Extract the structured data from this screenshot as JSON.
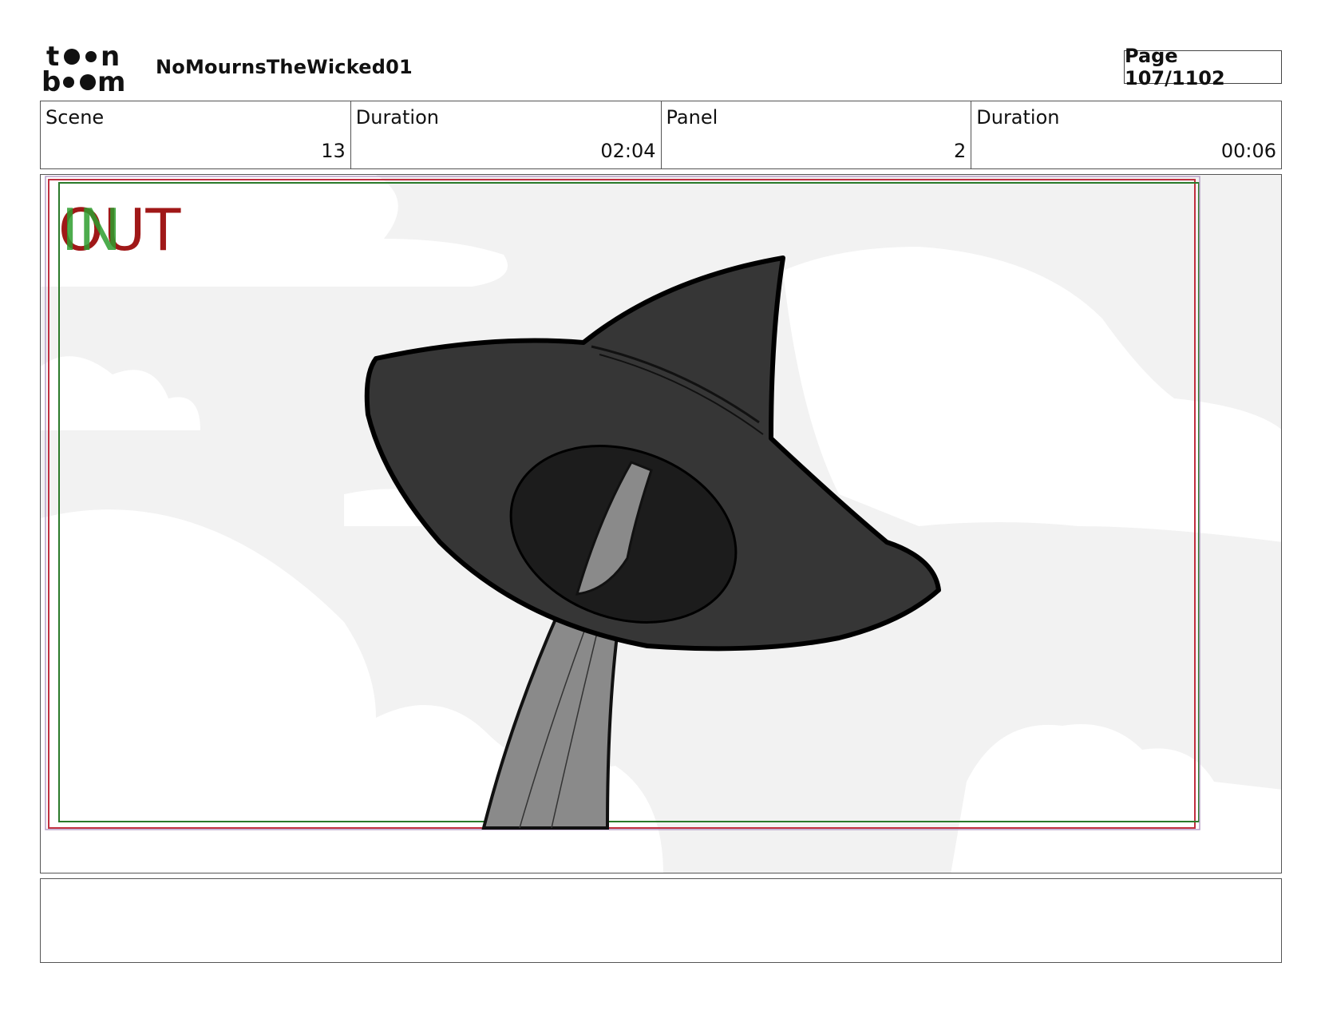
{
  "header": {
    "logo_text_top": "toon",
    "logo_text_bottom": "boom",
    "project_title": "NoMournsTheWicked01",
    "page_label": "Page 107/1102"
  },
  "info": {
    "scene_label": "Scene",
    "scene_value": "13",
    "scene_duration_label": "Duration",
    "scene_duration_value": "02:04",
    "panel_label": "Panel",
    "panel_value": "2",
    "panel_duration_label": "Duration",
    "panel_duration_value": "00:06"
  },
  "panel": {
    "in_label": "IN",
    "out_label": "OUT",
    "in_color": "#2e9e2e",
    "out_color": "#a01818"
  },
  "caption": {
    "text": ""
  }
}
